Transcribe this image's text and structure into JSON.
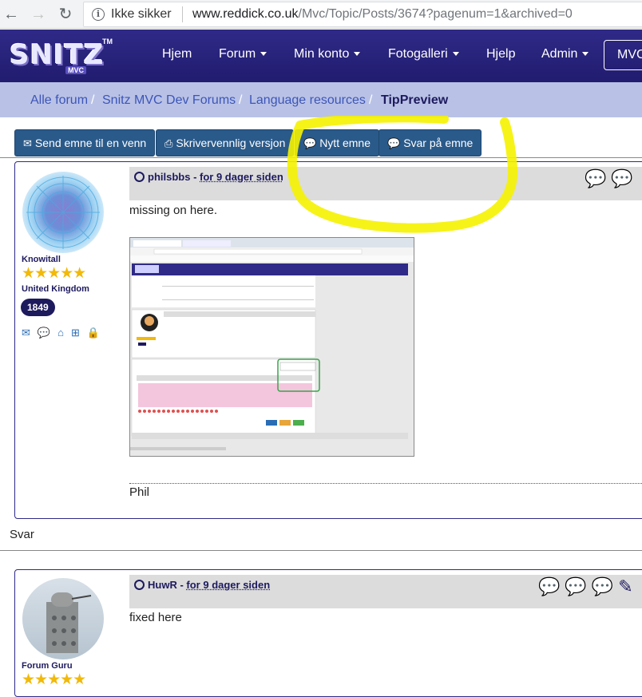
{
  "browser": {
    "security": "Ikke sikker",
    "url_host": "www.reddick.co.uk",
    "url_path": "/Mvc/Topic/Posts/3674?pagenum=1&archived=0"
  },
  "navbar": {
    "logo_text": "SNITZ",
    "logo_sub": "MVC",
    "logo_tm": "TM",
    "items": [
      "Hjem",
      "Forum",
      "Min konto",
      "Fotogalleri",
      "Hjelp",
      "Admin"
    ],
    "mvc_button": "MVC"
  },
  "breadcrumb": {
    "items": [
      "Alle forum",
      "Snitz MVC Dev Forums",
      "Language resources"
    ],
    "active": "TipPreview"
  },
  "actions": {
    "send": "Send emne til en venn",
    "print": "Skrivervennlig versjon",
    "new_topic": "Nytt emne",
    "reply": "Svar på emne"
  },
  "posts": [
    {
      "author": "philsbbs",
      "separator": " - ",
      "when": " for 9 dager siden ",
      "rank": "Knowitall",
      "country": "United Kingdom",
      "post_count": "1849",
      "body": "missing on here.",
      "signature": "Phil",
      "stars": "★★★★★"
    },
    {
      "author": "HuwR",
      "separator": " - ",
      "when": " for 9 dager siden ",
      "rank": "Forum Guru",
      "body": "fixed here",
      "stars": "★★★★★"
    }
  ],
  "reply_label": "Svar",
  "colors": {
    "navbar": "#2f2a87",
    "breadcrumb_bg": "#b9c2e6",
    "button_bg": "#2a5a8a",
    "highlight": "#f5f200"
  }
}
